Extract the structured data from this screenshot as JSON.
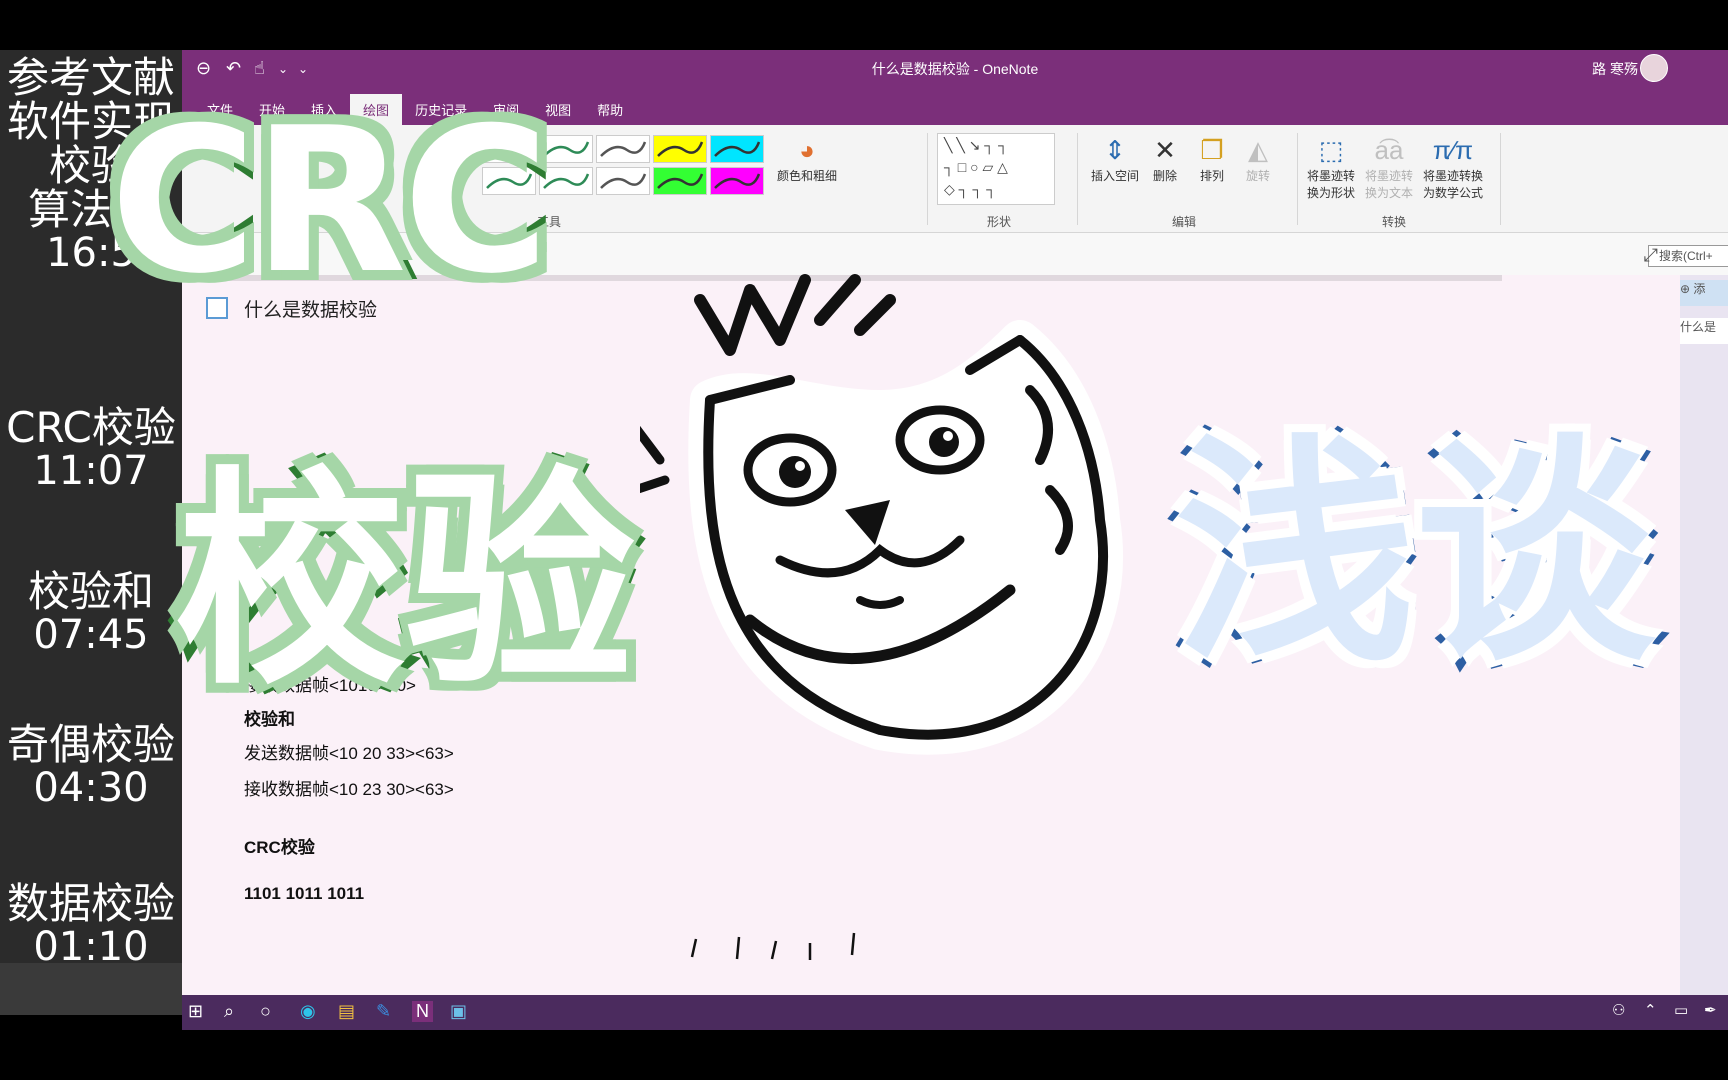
{
  "chapters": [
    {
      "title_lines": [
        "参考文献",
        "软件实现",
        "校验",
        "算法推"
      ],
      "time": "16:5"
    },
    {
      "title": "CRC校验",
      "time": "11:07"
    },
    {
      "title": "校验和",
      "time": "07:45"
    },
    {
      "title": "奇偶校验",
      "time": "04:30"
    },
    {
      "title": "数据校验",
      "time": "01:10"
    }
  ],
  "window": {
    "title": "什么是数据校验 - OneNote",
    "user": "路 寒殇",
    "menu_tabs": [
      "文件",
      "开始",
      "插入",
      "绘图",
      "历史记录",
      "审阅",
      "视图",
      "帮助"
    ],
    "active_tab": "绘图"
  },
  "ribbon": {
    "color_thickness": "颜色和粗细",
    "group_tools": "工具",
    "group_shapes": "形状",
    "group_edit": "编辑",
    "group_convert": "转换",
    "insert_space": "插入空间",
    "delete": "删除",
    "arrange": "排列",
    "rotate": "旋转",
    "ink_to_shape": [
      "将墨迹转",
      "换为形状"
    ],
    "ink_to_text": [
      "将墨迹转",
      "换为文本"
    ],
    "ink_to_math": [
      "将墨迹转换",
      "为数学公式"
    ],
    "pen_colors": [
      "#2e8b57",
      "#2e8b57",
      "#555555",
      "#ffff00",
      "#00e5ff",
      "#2e8b57",
      "#2e8b57",
      "#555555",
      "#33ff33",
      "#ff00ff"
    ]
  },
  "search": {
    "placeholder": "搜索(Ctrl+"
  },
  "sidebar": {
    "add_page": "添",
    "page": "什么是"
  },
  "page": {
    "title": "什么是数据校验",
    "lines": [
      {
        "text": "接收数据帧<1010><0>",
        "bold": false
      },
      {
        "text": "校验和",
        "bold": true
      },
      {
        "text": "发送数据帧<10 20 33><63>",
        "bold": false
      },
      {
        "text": "接收数据帧<10 23 30><63>",
        "bold": false
      },
      {
        "text": "CRC校验",
        "bold": true
      },
      {
        "text": "1101 1011  1011",
        "bold": true
      }
    ]
  },
  "overlay": {
    "crc": "CRC",
    "jiaoyan": "校验",
    "qiantan": "浅谈"
  },
  "colors": {
    "onenote_purple": "#7b2f7a",
    "green_stroke": "#2e7d32",
    "blue_stroke": "#2d5fa3"
  }
}
